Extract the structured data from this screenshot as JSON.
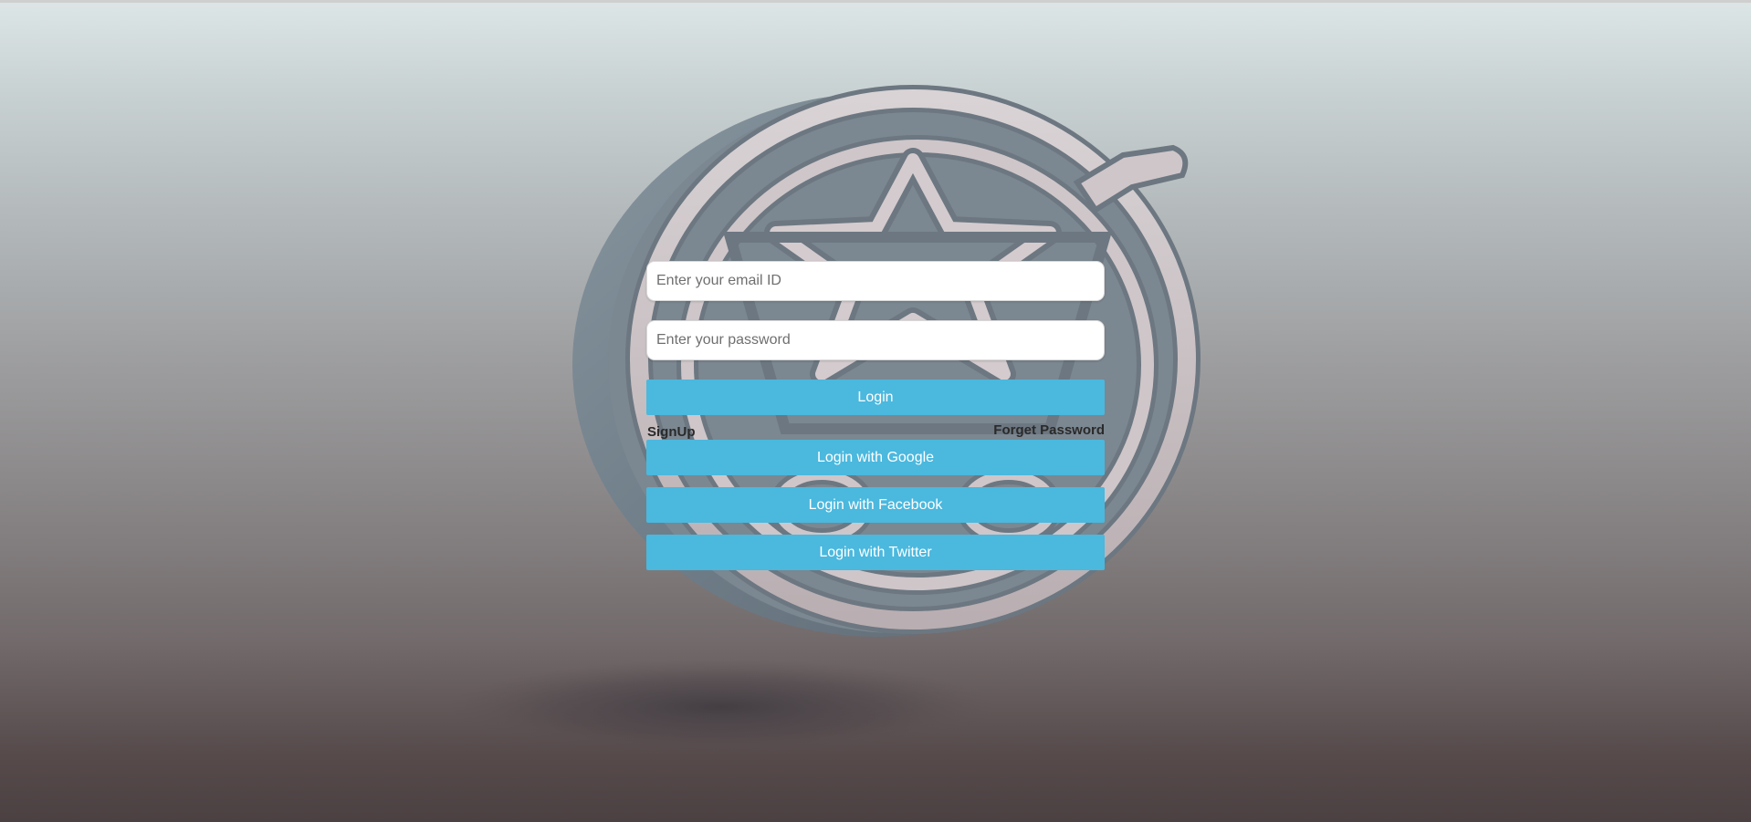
{
  "form": {
    "email_placeholder": "Enter your email ID",
    "password_placeholder": "Enter your password",
    "login_label": "Login",
    "signup_label": "SignUp",
    "forget_password_label": "Forget Password",
    "google_label": "Login with Google",
    "facebook_label": "Login with Facebook",
    "twitter_label": "Login with Twitter"
  },
  "colors": {
    "button": "#4bb8de",
    "button_text": "#ffffff",
    "link_text": "#2a2a2a"
  },
  "background": {
    "emblem_icon": "star-cart-emblem-icon"
  }
}
